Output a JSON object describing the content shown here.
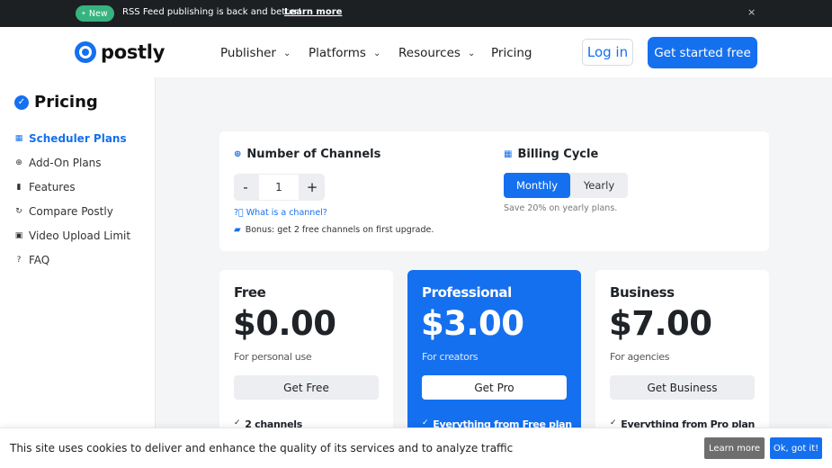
{
  "announcement": {
    "badge": "New",
    "message": "RSS Feed publishing is back and better!",
    "link": "Learn more",
    "close_icon": "×"
  },
  "header": {
    "logo_text": "postly",
    "nav": [
      {
        "label": "Publisher",
        "has_dropdown": true
      },
      {
        "label": "Platforms",
        "has_dropdown": true
      },
      {
        "label": "Resources",
        "has_dropdown": true
      },
      {
        "label": "Pricing",
        "has_dropdown": false
      }
    ],
    "login": "Log in",
    "cta": "Get started free"
  },
  "sidebar": {
    "title": "Pricing",
    "items": [
      {
        "label": "Scheduler Plans",
        "icon": "calendar-icon",
        "active": true
      },
      {
        "label": "Add-On Plans",
        "icon": "plus-circle-icon",
        "active": false
      },
      {
        "label": "Features",
        "icon": "bar-chart-icon",
        "active": false
      },
      {
        "label": "Compare Postly",
        "icon": "refresh-icon",
        "active": false
      },
      {
        "label": "Video Upload Limit",
        "icon": "video-icon",
        "active": false
      },
      {
        "label": "FAQ",
        "icon": "question-icon",
        "active": false
      }
    ]
  },
  "config": {
    "channels_title": "Number of Channels",
    "stepper_minus": "-",
    "stepper_value": "1",
    "stepper_plus": "+",
    "channel_help": "What is a channel?",
    "bonus": "Bonus: get 2 free channels on first upgrade.",
    "billing_title": "Billing Cycle",
    "billing_options": [
      "Monthly",
      "Yearly"
    ],
    "billing_selected": "Monthly",
    "save_note": "Save 20% on yearly plans."
  },
  "plans": [
    {
      "name": "Free",
      "price": "$0.00",
      "desc": "For personal use",
      "cta": "Get Free",
      "feature": "2 channels"
    },
    {
      "name": "Professional",
      "price": "$3.00",
      "desc": "For creators",
      "cta": "Get Pro",
      "feature": "Everything from Free plan"
    },
    {
      "name": "Business",
      "price": "$7.00",
      "desc": "For agencies",
      "cta": "Get Business",
      "feature": "Everything from Pro plan"
    }
  ],
  "cookie": {
    "text": "This site uses cookies to deliver and enhance the quality of its services and to analyze traffic",
    "learn": "Learn more",
    "ok": "Ok, got it!"
  },
  "colors": {
    "accent": "#1570ef",
    "badge_green": "#36b37e",
    "topbar": "#1d2023"
  }
}
